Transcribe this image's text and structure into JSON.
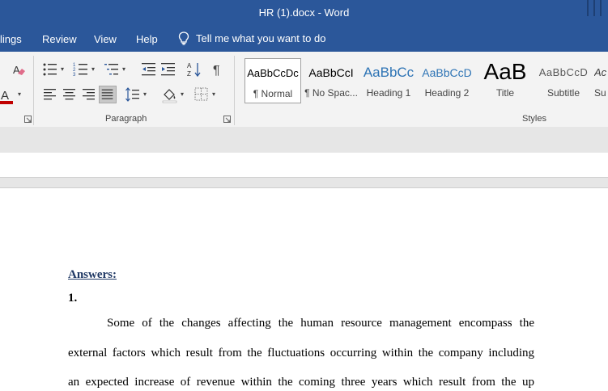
{
  "titlebar": {
    "title": "HR (1).docx  -  Word"
  },
  "tabs": [
    {
      "label": "lings"
    },
    {
      "label": "Review"
    },
    {
      "label": "View"
    },
    {
      "label": "Help"
    }
  ],
  "tellme": {
    "label": "Tell me what you want to do",
    "icon": "lightbulb-icon"
  },
  "groups": {
    "paragraph": "Paragraph",
    "styles": "Styles"
  },
  "styles": [
    {
      "preview": "AaBbCcDc",
      "name": "¶ Normal",
      "selected": true
    },
    {
      "preview": "AaBbCcI",
      "name": "¶ No Spac..."
    },
    {
      "preview": "AaBbCc",
      "name": "Heading 1"
    },
    {
      "preview": "AaBbCcD",
      "name": "Heading 2"
    },
    {
      "preview": "AaB",
      "name": "Title"
    },
    {
      "preview": "AaBbCcD",
      "name": "Subtitle"
    },
    {
      "preview": "Ac",
      "name": "Su"
    }
  ],
  "document": {
    "heading": "Answers:",
    "item_number": "1.",
    "lines": [
      "Some of the changes affecting the human resource management encompass the",
      "external factors which result from the fluctuations occurring within the company including",
      "an expected increase of revenue within the coming three years which result from the up"
    ]
  },
  "colors": {
    "brand": "#2b579a",
    "heading_text": "#1f3864",
    "ribbon_bg": "#f3f3f3",
    "font_color_bar": "#c00000"
  }
}
